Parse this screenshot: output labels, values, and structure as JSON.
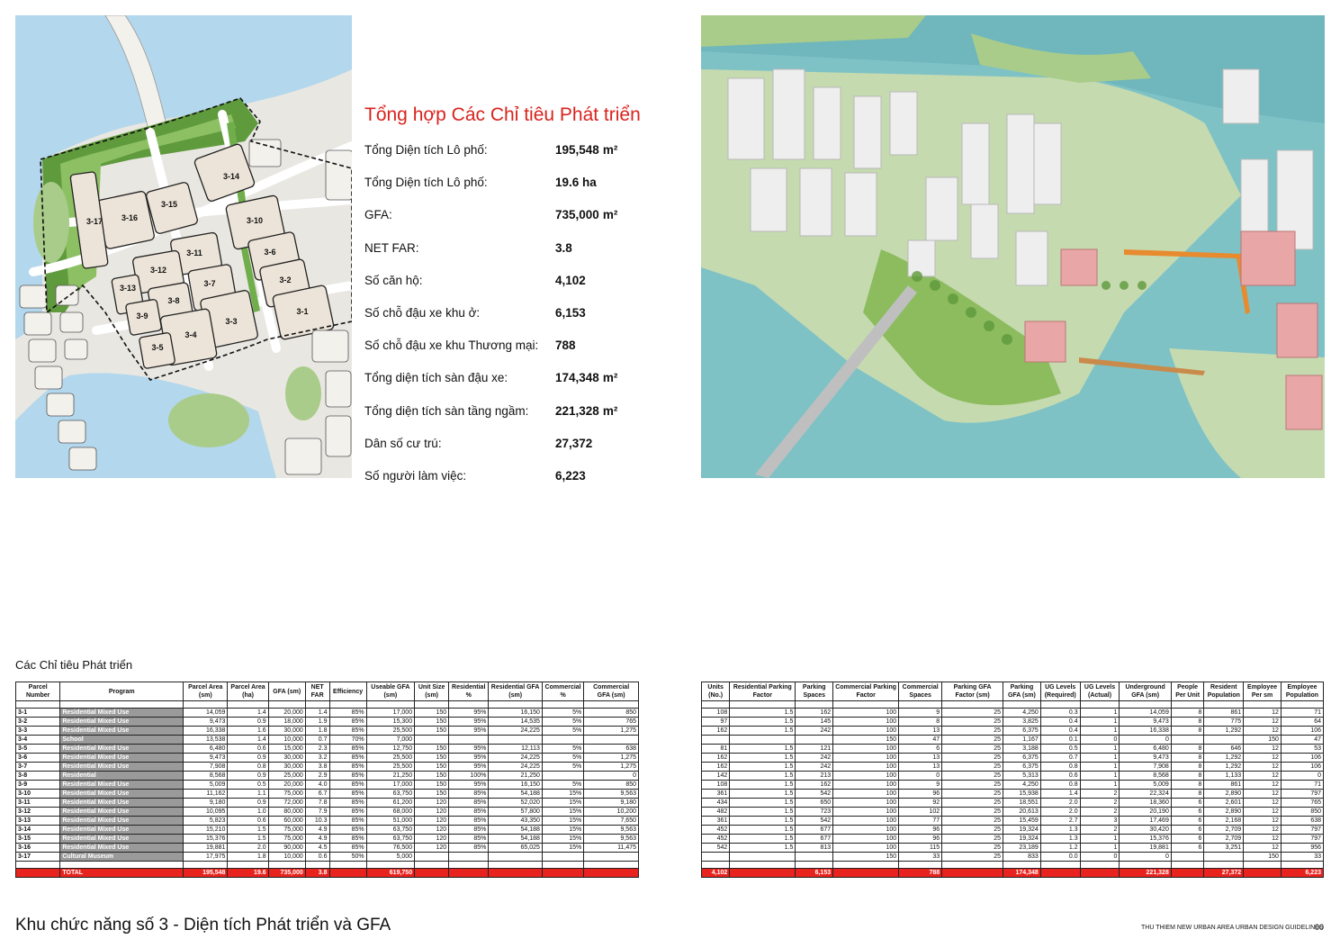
{
  "stats": {
    "title": "Tổng hợp Các Chỉ tiêu Phát triển",
    "rows": [
      {
        "label": "Tổng Diện tích Lô phố:",
        "value": "195,548",
        "unit": "m²"
      },
      {
        "label": "Tổng Diện tích Lô phố:",
        "value": "19.6 ha",
        "unit": ""
      },
      {
        "label": "GFA:",
        "value": "735,000",
        "unit": "m²"
      },
      {
        "label": "NET FAR:",
        "value": "3.8",
        "unit": ""
      },
      {
        "label": "Số căn hộ:",
        "value": "4,102",
        "unit": ""
      },
      {
        "label": "Số chỗ đậu xe khu ở:",
        "value": "6,153",
        "unit": ""
      },
      {
        "label": "Số chỗ đậu xe khu Thương mại:",
        "value": "788",
        "unit": ""
      },
      {
        "label": "Tổng diện tích sàn đậu xe:",
        "value": "174,348",
        "unit": "m²"
      },
      {
        "label": "Tổng diện tích sàn tầng ngầm:",
        "value": "221,328",
        "unit": "m²"
      },
      {
        "label": "Dân số cư trú:",
        "value": "27,372",
        "unit": ""
      },
      {
        "label": "Số người làm việc:",
        "value": "6,223",
        "unit": ""
      }
    ]
  },
  "map": {
    "parcel_labels": [
      "3-1",
      "3-2",
      "3-3",
      "3-4",
      "3-5",
      "3-6",
      "3-7",
      "3-8",
      "3-9",
      "3-10",
      "3-11",
      "3-12",
      "3-13",
      "3-14",
      "3-15",
      "3-16",
      "3-17"
    ]
  },
  "table_caption": "Các Chỉ tiêu Phát triển",
  "left_table": {
    "headers": [
      "Parcel Number",
      "Program",
      "Parcel Area (sm)",
      "Parcel Area (ha)",
      "GFA (sm)",
      "NET FAR",
      "Efficiency",
      "Useable GFA (sm)",
      "Unit Size (sm)",
      "Residential %",
      "Residential GFA (sm)",
      "Commercial %",
      "Commercial GFA (sm)"
    ],
    "rows": [
      [
        "3-1",
        "Residential Mixed Use",
        "14,059",
        "1.4",
        "20,000",
        "1.4",
        "85%",
        "17,000",
        "150",
        "95%",
        "16,150",
        "5%",
        "850"
      ],
      [
        "3-2",
        "Residential Mixed Use",
        "9,473",
        "0.9",
        "18,000",
        "1.9",
        "85%",
        "15,300",
        "150",
        "95%",
        "14,535",
        "5%",
        "765"
      ],
      [
        "3-3",
        "Residential Mixed Use",
        "16,338",
        "1.6",
        "30,000",
        "1.8",
        "85%",
        "25,500",
        "150",
        "95%",
        "24,225",
        "5%",
        "1,275"
      ],
      [
        "3-4",
        "School",
        "13,538",
        "1.4",
        "10,000",
        "0.7",
        "70%",
        "7,000",
        "",
        "",
        "",
        "",
        ""
      ],
      [
        "3-5",
        "Residential Mixed Use",
        "6,480",
        "0.6",
        "15,000",
        "2.3",
        "85%",
        "12,750",
        "150",
        "95%",
        "12,113",
        "5%",
        "638"
      ],
      [
        "3-6",
        "Residential Mixed Use",
        "9,473",
        "0.9",
        "30,000",
        "3.2",
        "85%",
        "25,500",
        "150",
        "95%",
        "24,225",
        "5%",
        "1,275"
      ],
      [
        "3-7",
        "Residential Mixed Use",
        "7,908",
        "0.8",
        "30,000",
        "3.8",
        "85%",
        "25,500",
        "150",
        "95%",
        "24,225",
        "5%",
        "1,275"
      ],
      [
        "3-8",
        "Residential",
        "8,568",
        "0.9",
        "25,000",
        "2.9",
        "85%",
        "21,250",
        "150",
        "100%",
        "21,250",
        "",
        "0"
      ],
      [
        "3-9",
        "Residential Mixed Use",
        "5,009",
        "0.5",
        "20,000",
        "4.0",
        "85%",
        "17,000",
        "150",
        "95%",
        "16,150",
        "5%",
        "850"
      ],
      [
        "3-10",
        "Residential Mixed Use",
        "11,162",
        "1.1",
        "75,000",
        "6.7",
        "85%",
        "63,750",
        "150",
        "85%",
        "54,188",
        "15%",
        "9,563"
      ],
      [
        "3-11",
        "Residential Mixed Use",
        "9,180",
        "0.9",
        "72,000",
        "7.8",
        "85%",
        "61,200",
        "120",
        "85%",
        "52,020",
        "15%",
        "9,180"
      ],
      [
        "3-12",
        "Residential Mixed Use",
        "10,095",
        "1.0",
        "80,000",
        "7.9",
        "85%",
        "68,000",
        "120",
        "85%",
        "57,800",
        "15%",
        "10,200"
      ],
      [
        "3-13",
        "Residential Mixed Use",
        "5,823",
        "0.6",
        "60,000",
        "10.3",
        "85%",
        "51,000",
        "120",
        "85%",
        "43,350",
        "15%",
        "7,650"
      ],
      [
        "3-14",
        "Residential Mixed Use",
        "15,210",
        "1.5",
        "75,000",
        "4.9",
        "85%",
        "63,750",
        "120",
        "85%",
        "54,188",
        "15%",
        "9,563"
      ],
      [
        "3-15",
        "Residential Mixed Use",
        "15,376",
        "1.5",
        "75,000",
        "4.9",
        "85%",
        "63,750",
        "120",
        "85%",
        "54,188",
        "15%",
        "9,563"
      ],
      [
        "3-16",
        "Residential Mixed Use",
        "19,881",
        "2.0",
        "90,000",
        "4.5",
        "85%",
        "76,500",
        "120",
        "85%",
        "65,025",
        "15%",
        "11,475"
      ],
      [
        "3-17",
        "Cultural Museum",
        "17,975",
        "1.8",
        "10,000",
        "0.6",
        "50%",
        "5,000",
        "",
        "",
        "",
        "",
        ""
      ]
    ],
    "total": [
      "",
      "TOTAL",
      "195,548",
      "19.6",
      "735,000",
      "3.8",
      "",
      "619,750",
      "",
      "",
      "",
      "",
      ""
    ]
  },
  "right_table": {
    "headers": [
      "Units (No.)",
      "Residential Parking Factor",
      "Parking Spaces",
      "Commercial Parking Factor",
      "Commercial Spaces",
      "Parking GFA Factor (sm)",
      "Parking GFA (sm)",
      "UG Levels (Required)",
      "UG Levels (Actual)",
      "Underground GFA (sm)",
      "People Per Unit",
      "Resident Population",
      "Employee Per sm",
      "Employee Population"
    ],
    "rows": [
      [
        "108",
        "1.5",
        "162",
        "100",
        "9",
        "25",
        "4,250",
        "0.3",
        "1",
        "14,059",
        "8",
        "861",
        "12",
        "71"
      ],
      [
        "97",
        "1.5",
        "145",
        "100",
        "8",
        "25",
        "3,825",
        "0.4",
        "1",
        "9,473",
        "8",
        "775",
        "12",
        "64"
      ],
      [
        "162",
        "1.5",
        "242",
        "100",
        "13",
        "25",
        "6,375",
        "0.4",
        "1",
        "16,338",
        "8",
        "1,292",
        "12",
        "106"
      ],
      [
        "",
        "",
        "",
        "150",
        "47",
        "25",
        "1,167",
        "0.1",
        "0",
        "0",
        "",
        "",
        "150",
        "47"
      ],
      [
        "81",
        "1.5",
        "121",
        "100",
        "6",
        "25",
        "3,188",
        "0.5",
        "1",
        "6,480",
        "8",
        "646",
        "12",
        "53"
      ],
      [
        "162",
        "1.5",
        "242",
        "100",
        "13",
        "25",
        "6,375",
        "0.7",
        "1",
        "9,473",
        "8",
        "1,292",
        "12",
        "106"
      ],
      [
        "162",
        "1.5",
        "242",
        "100",
        "13",
        "25",
        "6,375",
        "0.8",
        "1",
        "7,908",
        "8",
        "1,292",
        "12",
        "106"
      ],
      [
        "142",
        "1.5",
        "213",
        "100",
        "0",
        "25",
        "5,313",
        "0.6",
        "1",
        "8,568",
        "8",
        "1,133",
        "12",
        "0"
      ],
      [
        "108",
        "1.5",
        "162",
        "100",
        "9",
        "25",
        "4,250",
        "0.8",
        "1",
        "5,009",
        "8",
        "861",
        "12",
        "71"
      ],
      [
        "361",
        "1.5",
        "542",
        "100",
        "96",
        "25",
        "15,938",
        "1.4",
        "2",
        "22,324",
        "8",
        "2,890",
        "12",
        "797"
      ],
      [
        "434",
        "1.5",
        "650",
        "100",
        "92",
        "25",
        "18,551",
        "2.0",
        "2",
        "18,360",
        "6",
        "2,601",
        "12",
        "765"
      ],
      [
        "482",
        "1.5",
        "723",
        "100",
        "102",
        "25",
        "20,613",
        "2.0",
        "2",
        "20,190",
        "6",
        "2,890",
        "12",
        "850"
      ],
      [
        "361",
        "1.5",
        "542",
        "100",
        "77",
        "25",
        "15,459",
        "2.7",
        "3",
        "17,469",
        "6",
        "2,168",
        "12",
        "638"
      ],
      [
        "452",
        "1.5",
        "677",
        "100",
        "96",
        "25",
        "19,324",
        "1.3",
        "2",
        "30,420",
        "6",
        "2,709",
        "12",
        "797"
      ],
      [
        "452",
        "1.5",
        "677",
        "100",
        "96",
        "25",
        "19,324",
        "1.3",
        "1",
        "15,376",
        "6",
        "2,709",
        "12",
        "797"
      ],
      [
        "542",
        "1.5",
        "813",
        "100",
        "115",
        "25",
        "23,189",
        "1.2",
        "1",
        "19,881",
        "6",
        "3,251",
        "12",
        "956"
      ],
      [
        "",
        "",
        "",
        "150",
        "33",
        "25",
        "833",
        "0.0",
        "0",
        "0",
        "",
        "",
        "150",
        "33"
      ]
    ],
    "total": [
      "4,102",
      "",
      "6,153",
      "",
      "788",
      "",
      "174,348",
      "",
      "",
      "221,328",
      "",
      "27,372",
      "",
      "6,223"
    ]
  },
  "footer": {
    "title": "Khu chức năng số 3 - Diện tích Phát triển và GFA",
    "guide": "THU THIEM NEW URBAN AREA URBAN DESIGN GUIDELINES",
    "page": "00"
  },
  "colors": {
    "accent_red": "#d9231d",
    "total_row_red": "#e8231e",
    "water": "#aed3ea",
    "park_green": "#5a9a3a",
    "parcel_fill": "#ece4d8"
  }
}
